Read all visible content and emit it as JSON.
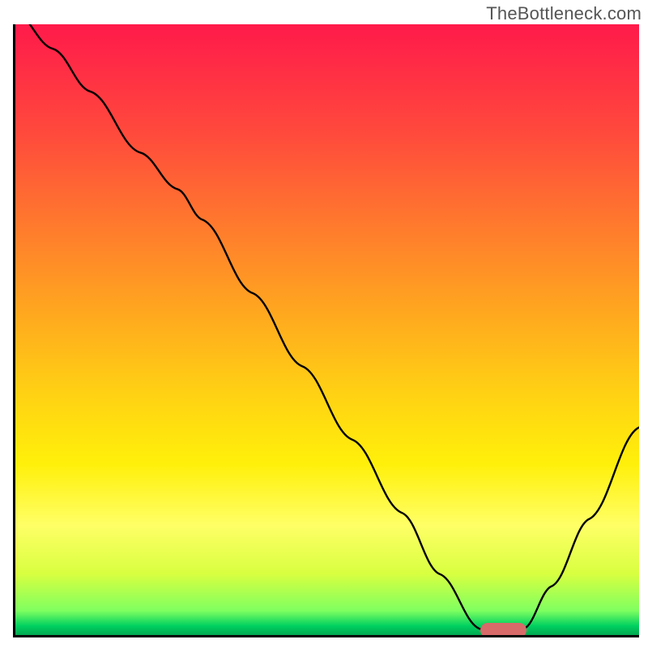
{
  "watermark": "TheBottleneck.com",
  "chart_data": {
    "type": "line",
    "title": "",
    "xlabel": "",
    "ylabel": "",
    "xlim": [
      0,
      100
    ],
    "ylim": [
      0,
      100
    ],
    "grid": false,
    "legend": false,
    "series": [
      {
        "name": "bottleneck-curve",
        "x": [
          0,
          6,
          12,
          20,
          26,
          30,
          38,
          46,
          54,
          62,
          68,
          74.5,
          81.5,
          86,
          92,
          100
        ],
        "values": [
          102,
          96,
          89,
          79,
          73,
          68,
          56,
          44,
          32,
          20,
          10,
          1,
          1,
          8,
          19,
          34
        ]
      }
    ],
    "annotations": [
      {
        "name": "optimal-range-marker",
        "x_start": 74.5,
        "x_end": 82,
        "y": 0.8,
        "color": "#d86a6a"
      }
    ],
    "background_gradient": {
      "type": "vertical",
      "stops": [
        {
          "pos": 0,
          "color": "#ff1a4a"
        },
        {
          "pos": 50,
          "color": "#ffaa1e"
        },
        {
          "pos": 78,
          "color": "#ffff66"
        },
        {
          "pos": 100,
          "color": "#00a850"
        }
      ]
    }
  }
}
